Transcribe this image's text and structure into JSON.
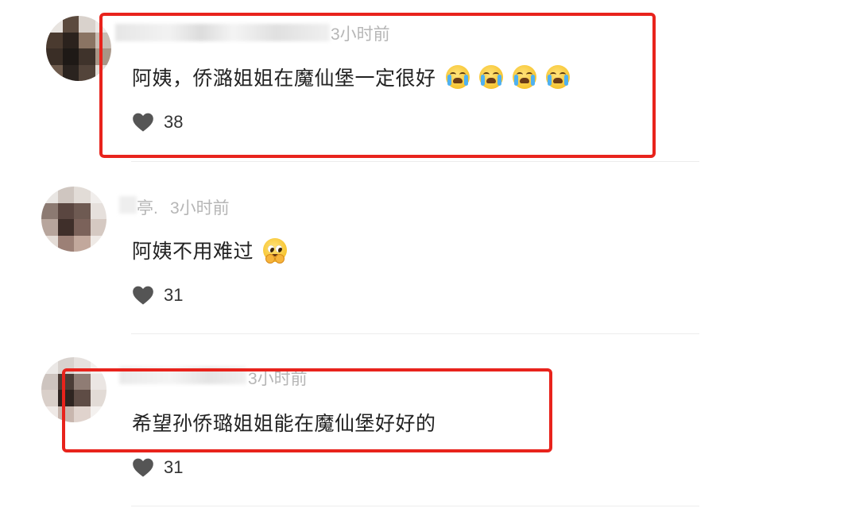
{
  "comments": [
    {
      "time": "3小时前",
      "text": "阿姨，侨潞姐姐在魔仙堡一定很好",
      "emojis": [
        "loudly-crying-face",
        "loudly-crying-face",
        "loudly-crying-face",
        "loudly-crying-face"
      ],
      "likes": "38",
      "highlighted": true
    },
    {
      "name_fragment": "亭.",
      "time": "3小时前",
      "text": "阿姨不用难过",
      "emojis": [
        "pleading-face"
      ],
      "likes": "31",
      "highlighted": false
    },
    {
      "time": "3小时前",
      "text": "希望孙侨璐姐姐能在魔仙堡好好的",
      "emojis": [],
      "likes": "31",
      "highlighted": true
    }
  ],
  "colors": {
    "highlight_border": "#e8231c",
    "time_text": "#b6b6b6",
    "body_text": "#222222",
    "like_icon": "#555555"
  },
  "icons": {
    "like": "heart-icon"
  }
}
